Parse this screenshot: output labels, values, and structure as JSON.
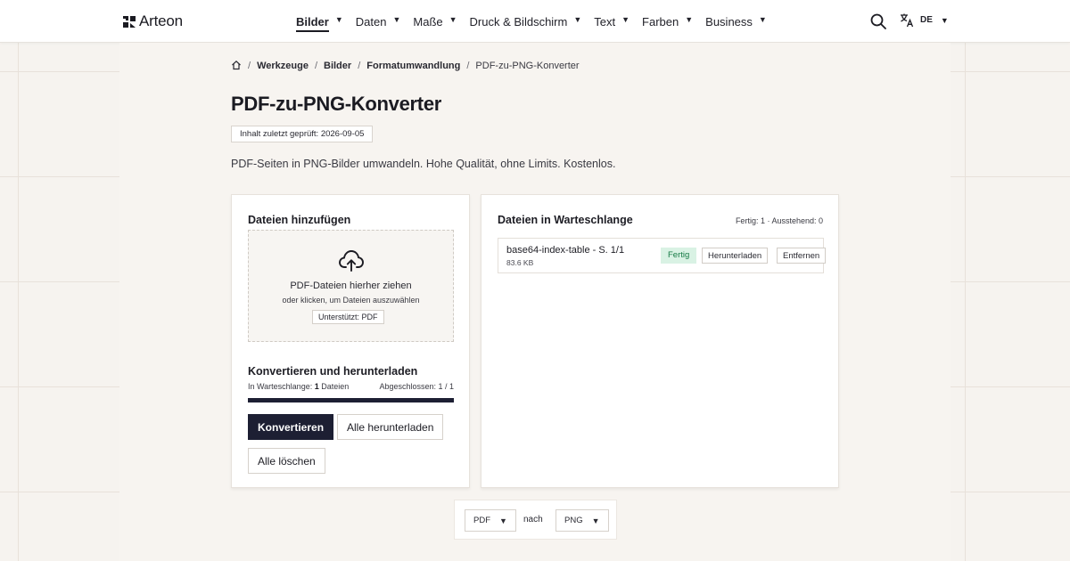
{
  "header": {
    "brand": "Arteon",
    "nav": [
      {
        "label": "Bilder",
        "active": true
      },
      {
        "label": "Daten",
        "active": false
      },
      {
        "label": "Maße",
        "active": false
      },
      {
        "label": "Druck & Bildschirm",
        "active": false
      },
      {
        "label": "Text",
        "active": false
      },
      {
        "label": "Farben",
        "active": false
      },
      {
        "label": "Business",
        "active": false
      }
    ],
    "search_icon": "search-icon",
    "language_icon": "translate-icon",
    "language_code": "DE"
  },
  "breadcrumb": {
    "home_icon": "home-icon",
    "items": [
      "Werkzeuge",
      "Bilder",
      "Formatumwandlung"
    ],
    "current": "PDF-zu-PNG-Konverter",
    "separator": "/"
  },
  "page": {
    "title": "PDF-zu-PNG-Konverter",
    "reviewed_badge": "Inhalt zuletzt geprüft: 2026-09-05",
    "subtitle": "PDF-Seiten in PNG-Bilder umwandeln. Hohe Qualität, ohne Limits. Kostenlos."
  },
  "upload_card": {
    "title": "Dateien hinzufügen",
    "dropzone_icon": "cloud-upload-icon",
    "dropzone_title": "PDF-Dateien hierher ziehen",
    "dropzone_hint": "oder klicken, um Dateien auszuwählen",
    "supported_label": "Unterstützt: PDF",
    "convert_title": "Konvertieren und herunterladen",
    "queue_label": "In Warteschlange:",
    "queue_count": "1",
    "queue_unit": "Dateien",
    "completed_label": "Abgeschlossen: 1 / 1",
    "progress": 1.0,
    "convert_button": "Konvertieren",
    "download_all_button": "Alle herunterladen",
    "clear_all_button": "Alle löschen"
  },
  "queue_card": {
    "title": "Dateien in Warteschlange",
    "stats": "Fertig: 1 · Ausstehend: 0",
    "files": [
      {
        "name": "base64-index-table - S. 1/1",
        "size": "83.6 KB",
        "status": "Fertig",
        "download_label": "Herunterladen",
        "remove_label": "Entfernen"
      }
    ]
  },
  "format_switch": {
    "from": "PDF",
    "connector": "nach",
    "to": "PNG"
  },
  "colors": {
    "primary": "#1d1f33",
    "success_bg": "#d9f2e4",
    "success_text": "#167a45",
    "page_bg": "#f6f3ef"
  }
}
